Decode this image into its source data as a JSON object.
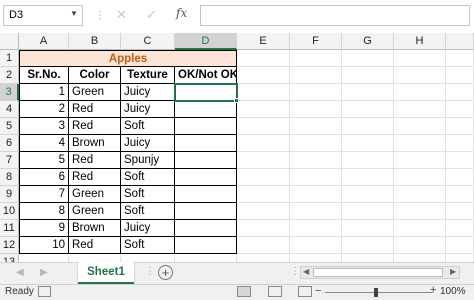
{
  "formula_bar": {
    "name_box": "D3",
    "cancel_icon": "✕",
    "enter_icon": "✓",
    "fx_label": "fx",
    "formula": ""
  },
  "columns": [
    "A",
    "B",
    "C",
    "D",
    "E",
    "F",
    "G",
    "H"
  ],
  "rows": [
    "1",
    "2",
    "3",
    "4",
    "5",
    "6",
    "7",
    "8",
    "9",
    "10",
    "11",
    "12",
    "13"
  ],
  "selected_cell": {
    "column": "D",
    "row": "3"
  },
  "sheet": {
    "title": "Apples",
    "headers": [
      "Sr.No.",
      "Color",
      "Texture",
      "OK/Not OK"
    ],
    "data": [
      [
        "1",
        "Green",
        "Juicy",
        ""
      ],
      [
        "2",
        "Red",
        "Juicy",
        ""
      ],
      [
        "3",
        "Red",
        "Soft",
        ""
      ],
      [
        "4",
        "Brown",
        "Juicy",
        ""
      ],
      [
        "5",
        "Red",
        "Spunjy",
        ""
      ],
      [
        "6",
        "Red",
        "Soft",
        ""
      ],
      [
        "7",
        "Green",
        "Soft",
        ""
      ],
      [
        "8",
        "Green",
        "Soft",
        ""
      ],
      [
        "9",
        "Brown",
        "Juicy",
        ""
      ],
      [
        "10",
        "Red",
        "Soft",
        ""
      ]
    ]
  },
  "tabs": {
    "active": "Sheet1",
    "add_label": "+"
  },
  "status": {
    "ready": "Ready",
    "zoom": "100%"
  },
  "colors": {
    "accent": "#217346",
    "title_fill": "#fce4d6",
    "title_text": "#c65911"
  }
}
